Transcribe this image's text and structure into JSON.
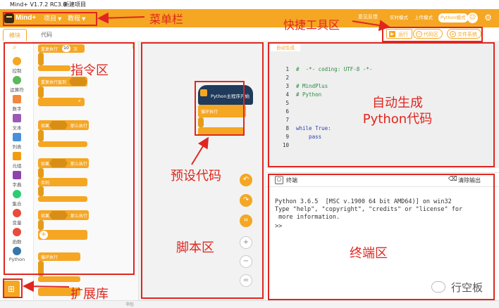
{
  "window": {
    "title": "Mind+ V1.7.2 RC3.0",
    "project": "新建项目"
  },
  "menubar": {
    "logo": "Mind+",
    "items": [
      "项目",
      "教程"
    ],
    "right": [
      "意见反馈"
    ],
    "modes": [
      "实时模式",
      "上传模式",
      "Python模式"
    ]
  },
  "toolbar": {
    "tabs": [
      "模块",
      "代码"
    ],
    "run": "运行",
    "code_btn": "代码区",
    "file_btn": "文件系统"
  },
  "categories": [
    {
      "label": "控制",
      "color": "#f5a623"
    },
    {
      "label": "运算符",
      "color": "#5cb85c"
    },
    {
      "label": "数字",
      "color": "#f0883e"
    },
    {
      "label": "文本",
      "color": "#9b59b6"
    },
    {
      "label": "列表",
      "color": "#4a90d9"
    },
    {
      "label": "元组",
      "color": "#f39c12"
    },
    {
      "label": "字典",
      "color": "#8e44ad"
    },
    {
      "label": "集合",
      "color": "#2ecc71"
    },
    {
      "label": "变量",
      "color": "#e74c3c"
    },
    {
      "label": "函数",
      "color": "#e74c3c"
    },
    {
      "label": "Python",
      "color": "#3776ab"
    }
  ],
  "palette": {
    "repeat_label": "重复执行",
    "repeat_count": "10",
    "repeat_suffix": "次",
    "repeat_until": "重复执行直到",
    "if_label": "如果",
    "then_label": "那么执行",
    "else_label": "否则",
    "forever": "循环执行"
  },
  "script": {
    "hat": "Python主程序开始",
    "loop": "循环执行"
  },
  "code": {
    "tab": "自动生成",
    "lines": [
      {
        "n": "1",
        "text": "#  -*- coding: UTF-8 -*-",
        "cls": "cmt"
      },
      {
        "n": "2",
        "text": "",
        "cls": ""
      },
      {
        "n": "3",
        "text": "# MindPlus",
        "cls": "cmt"
      },
      {
        "n": "4",
        "text": "# Python",
        "cls": "cmt"
      },
      {
        "n": "5",
        "text": "",
        "cls": ""
      },
      {
        "n": "6",
        "text": "",
        "cls": ""
      },
      {
        "n": "7",
        "text": "",
        "cls": ""
      },
      {
        "n": "8",
        "text": "while True:",
        "cls": "kw"
      },
      {
        "n": "9",
        "text": "    pass",
        "cls": "kw"
      },
      {
        "n": "10",
        "text": "",
        "cls": ""
      }
    ]
  },
  "terminal": {
    "title": "终端",
    "clear": "清除输出",
    "lines": [
      "Python 3.6.5  [MSC v.1900 64 bit AMD64)] on win32",
      "Type \"help\", \"copyright\", \"credits\" or \"license\" for",
      " more information.",
      ">>"
    ]
  },
  "annotations": {
    "menubar": "菜单栏",
    "quick": "快捷工具区",
    "commands": "指令区",
    "autogen_1": "自动生成",
    "autogen_2": "Python代码",
    "preset": "预设代码",
    "script": "脚本区",
    "terminal": "终端区",
    "extensions": "扩展库"
  },
  "watermark": "行空板",
  "status": "书包",
  "colors": {
    "accent": "#f5a623",
    "annotation": "#e0261f"
  }
}
